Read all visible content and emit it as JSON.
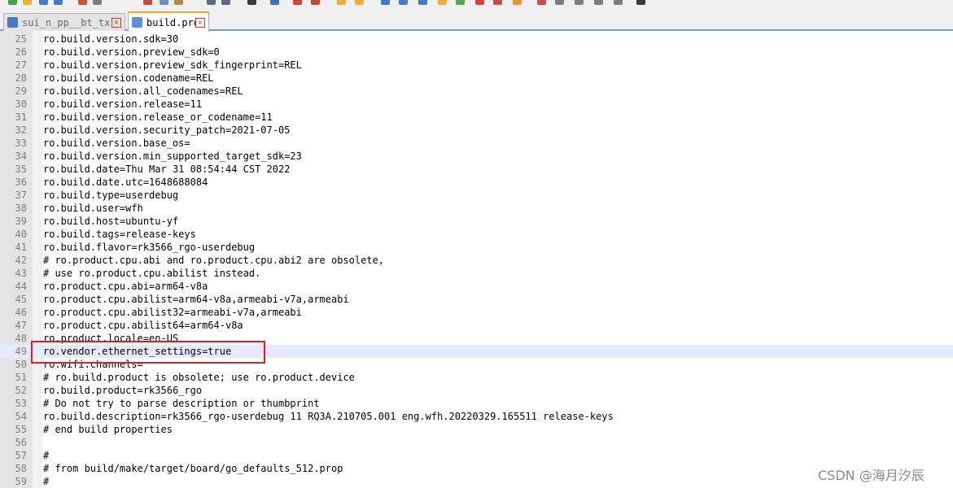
{
  "colors": {
    "highlight_border": "#e02020",
    "current_line": "#e8e8ff",
    "tab_accent": "#f5a623"
  },
  "tabs": [
    {
      "label": "sui_n_pp__bt_tx",
      "icon": "save-file-icon",
      "active": false
    },
    {
      "label": "build.prop",
      "icon": "save-file-icon",
      "active": true
    }
  ],
  "editor": {
    "current_line": 49,
    "lines": [
      {
        "n": "25",
        "t": "ro.build.version.sdk=30"
      },
      {
        "n": "26",
        "t": "ro.build.version.preview_sdk=0"
      },
      {
        "n": "27",
        "t": "ro.build.version.preview_sdk_fingerprint=REL"
      },
      {
        "n": "28",
        "t": "ro.build.version.codename=REL"
      },
      {
        "n": "29",
        "t": "ro.build.version.all_codenames=REL"
      },
      {
        "n": "30",
        "t": "ro.build.version.release=11"
      },
      {
        "n": "31",
        "t": "ro.build.version.release_or_codename=11"
      },
      {
        "n": "32",
        "t": "ro.build.version.security_patch=2021-07-05"
      },
      {
        "n": "33",
        "t": "ro.build.version.base_os="
      },
      {
        "n": "34",
        "t": "ro.build.version.min_supported_target_sdk=23"
      },
      {
        "n": "35",
        "t": "ro.build.date=Thu Mar 31 08:54:44 CST 2022"
      },
      {
        "n": "36",
        "t": "ro.build.date.utc=1648688084"
      },
      {
        "n": "37",
        "t": "ro.build.type=userdebug"
      },
      {
        "n": "38",
        "t": "ro.build.user=wfh"
      },
      {
        "n": "39",
        "t": "ro.build.host=ubuntu-yf"
      },
      {
        "n": "40",
        "t": "ro.build.tags=release-keys"
      },
      {
        "n": "41",
        "t": "ro.build.flavor=rk3566_rgo-userdebug"
      },
      {
        "n": "42",
        "t": "# ro.product.cpu.abi and ro.product.cpu.abi2 are obsolete,"
      },
      {
        "n": "43",
        "t": "# use ro.product.cpu.abilist instead."
      },
      {
        "n": "44",
        "t": "ro.product.cpu.abi=arm64-v8a"
      },
      {
        "n": "45",
        "t": "ro.product.cpu.abilist=arm64-v8a,armeabi-v7a,armeabi"
      },
      {
        "n": "46",
        "t": "ro.product.cpu.abilist32=armeabi-v7a,armeabi"
      },
      {
        "n": "47",
        "t": "ro.product.cpu.abilist64=arm64-v8a"
      },
      {
        "n": "48",
        "t": "ro.product.locale=en-US"
      },
      {
        "n": "49",
        "t": "ro.vendor.ethernet_settings=true"
      },
      {
        "n": "50",
        "t": "ro.wifi.channels="
      },
      {
        "n": "51",
        "t": "# ro.build.product is obsolete; use ro.product.device"
      },
      {
        "n": "52",
        "t": "ro.build.product=rk3566_rgo"
      },
      {
        "n": "53",
        "t": "# Do not try to parse description or thumbprint"
      },
      {
        "n": "54",
        "t": "ro.build.description=rk3566_rgo-userdebug 11 RQ3A.210705.001 eng.wfh.20220329.165511 release-keys"
      },
      {
        "n": "55",
        "t": "# end build properties"
      },
      {
        "n": "56",
        "t": ""
      },
      {
        "n": "57",
        "t": "#"
      },
      {
        "n": "58",
        "t": "# from build/make/target/board/go_defaults_512.prop"
      },
      {
        "n": "59",
        "t": "#"
      }
    ]
  },
  "watermark": "CSDN @海月汐辰"
}
